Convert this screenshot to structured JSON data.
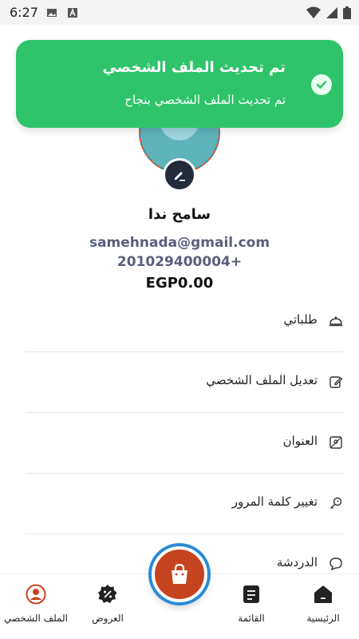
{
  "status_bar": {
    "time": "6:27",
    "icons": [
      "gallery-icon",
      "a-badge-icon",
      "wifi-icon",
      "signal-icon",
      "battery-icon"
    ]
  },
  "toast": {
    "title": "تم تحديث الملف الشخصي",
    "message": "تم تحديث الملف الشخصي بنجاح",
    "color": "#2fc46a",
    "icon": "check-circle-icon"
  },
  "profile": {
    "name": "سامح ندا",
    "email": "samehnada@gmail.com",
    "phone": "201029400004+",
    "balance": "EGP0.00",
    "edit_icon": "pencil-icon"
  },
  "menu": {
    "items": [
      {
        "label": "طلباتي",
        "icon": "dish-icon"
      },
      {
        "label": "تعديل الملف الشخصي",
        "icon": "edit-icon"
      },
      {
        "label": "العنوان",
        "icon": "map-icon"
      },
      {
        "label": "تغيير كلمة المرور",
        "icon": "key-icon"
      },
      {
        "label": "الدردشة",
        "icon": "chat-icon"
      }
    ]
  },
  "bottom_nav": {
    "items": [
      {
        "label": "الملف الشخصي",
        "icon": "user-icon",
        "active": true
      },
      {
        "label": "العروض",
        "icon": "percent-icon"
      },
      {
        "label": "القائمة",
        "icon": "document-icon"
      },
      {
        "label": "الرئيسية",
        "icon": "home-icon"
      }
    ],
    "fab_icon": "shopping-bag-icon",
    "accent": "#c6431f",
    "ring": "#2a8bd6"
  }
}
